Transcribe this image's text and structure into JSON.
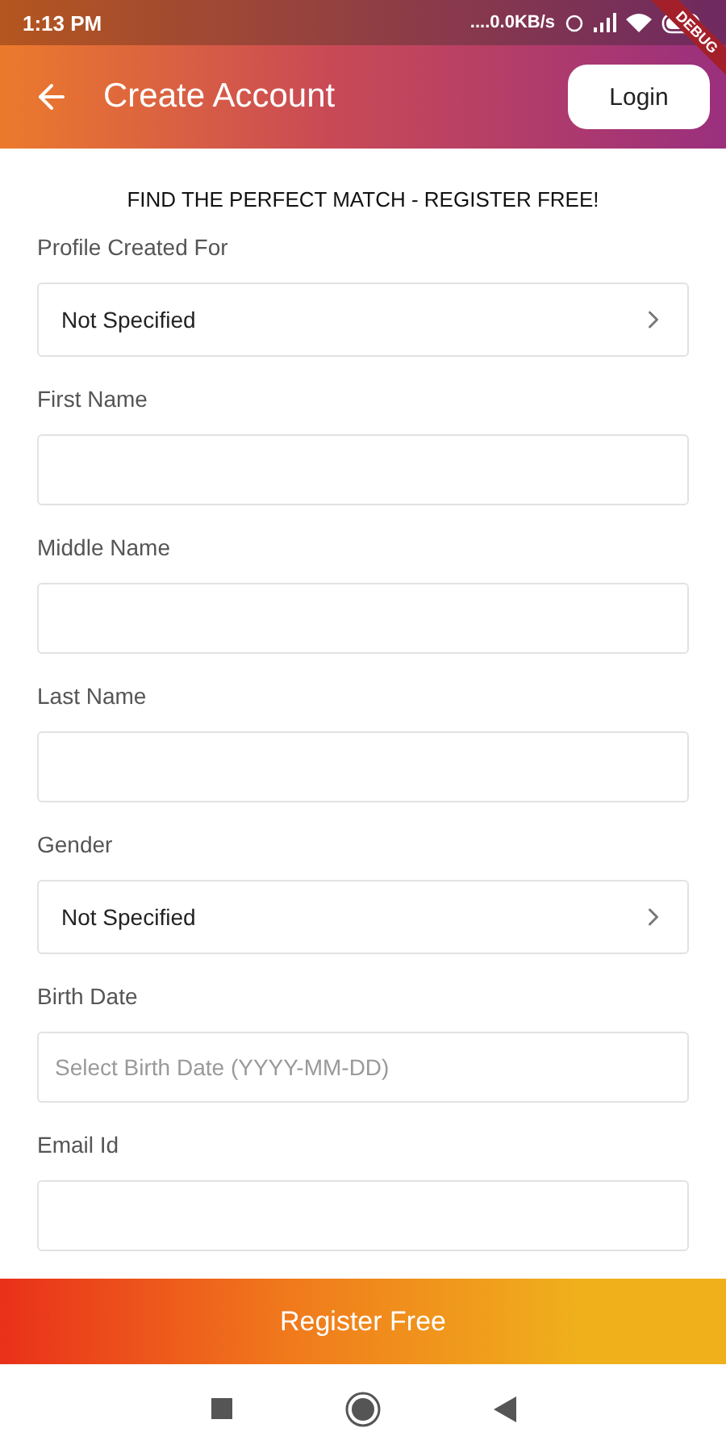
{
  "status_bar": {
    "time": "1:13 PM",
    "network_speed": "....0.0KB/s"
  },
  "debug_banner": "DEBUG",
  "app_bar": {
    "title": "Create Account",
    "login_button": "Login"
  },
  "heading": "FIND THE PERFECT MATCH - REGISTER FREE!",
  "fields": [
    {
      "label": "Profile Created For",
      "kind": "select",
      "value": "Not Specified"
    },
    {
      "label": "First Name",
      "kind": "text"
    },
    {
      "label": "Middle Name",
      "kind": "text"
    },
    {
      "label": "Last Name",
      "kind": "text"
    },
    {
      "label": "Gender",
      "kind": "select",
      "value": "Not Specified"
    },
    {
      "label": "Birth Date",
      "kind": "date",
      "placeholder": "Select Birth Date (YYYY-MM-DD)"
    },
    {
      "label": "Email Id",
      "kind": "text"
    }
  ],
  "register_button": "Register Free"
}
